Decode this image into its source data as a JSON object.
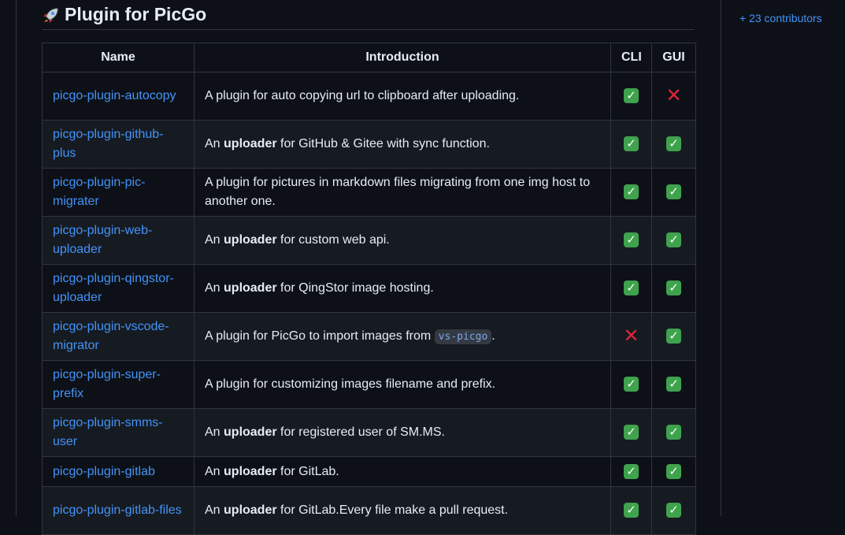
{
  "section": {
    "title": "Plugin for PicGo"
  },
  "sidebar": {
    "contributors_link": "+ 23 contributors"
  },
  "table": {
    "headers": [
      "Name",
      "Introduction",
      "CLI",
      "GUI"
    ],
    "rows": [
      {
        "name": "picgo-plugin-autocopy",
        "intro": [
          {
            "t": "A plugin for auto copying url to clipboard after uploading."
          }
        ],
        "cli": "check",
        "gui": "cross"
      },
      {
        "name": "picgo-plugin-github-plus",
        "intro": [
          {
            "t": "An "
          },
          {
            "b": "uploader"
          },
          {
            "t": " for GitHub & Gitee with sync function."
          }
        ],
        "cli": "check",
        "gui": "check"
      },
      {
        "name": "picgo-plugin-pic-migrater",
        "intro": [
          {
            "t": "A plugin for pictures in markdown files migrating from one img host to another one."
          }
        ],
        "cli": "check",
        "gui": "check"
      },
      {
        "name": "picgo-plugin-web-uploader",
        "intro": [
          {
            "t": "An "
          },
          {
            "b": "uploader"
          },
          {
            "t": " for custom web api."
          }
        ],
        "cli": "check",
        "gui": "check"
      },
      {
        "name": "picgo-plugin-qingstor-uploader",
        "intro": [
          {
            "t": "An "
          },
          {
            "b": "uploader"
          },
          {
            "t": " for QingStor image hosting."
          }
        ],
        "cli": "check",
        "gui": "check"
      },
      {
        "name": "picgo-plugin-vscode-migrator",
        "intro": [
          {
            "t": "A plugin for PicGo to import images from "
          },
          {
            "c": "vs-picgo"
          },
          {
            "t": "."
          }
        ],
        "cli": "cross",
        "gui": "check"
      },
      {
        "name": "picgo-plugin-super-prefix",
        "intro": [
          {
            "t": "A plugin for customizing images filename and prefix."
          }
        ],
        "cli": "check",
        "gui": "check"
      },
      {
        "name": "picgo-plugin-smms-user",
        "intro": [
          {
            "t": "An "
          },
          {
            "b": "uploader"
          },
          {
            "t": " for registered user of SM.MS."
          }
        ],
        "cli": "check",
        "gui": "check"
      },
      {
        "name": "picgo-plugin-gitlab",
        "intro": [
          {
            "t": "An "
          },
          {
            "b": "uploader"
          },
          {
            "t": " for GitLab."
          }
        ],
        "cli": "check",
        "gui": "check"
      },
      {
        "name": "picgo-plugin-gitlab-files",
        "intro": [
          {
            "t": "An "
          },
          {
            "b": "uploader"
          },
          {
            "t": " for GitLab.Every file make a pull request."
          }
        ],
        "cli": "check",
        "gui": "check"
      }
    ]
  }
}
